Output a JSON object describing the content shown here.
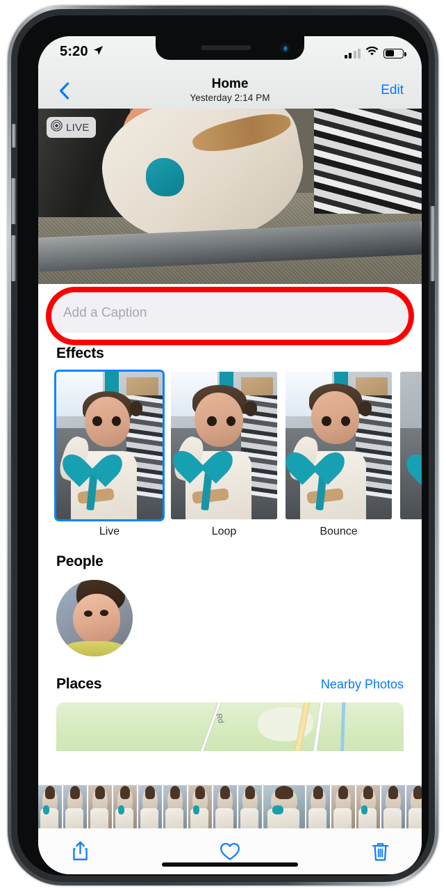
{
  "status_bar": {
    "time": "5:20",
    "location_icon": "location-arrow-icon",
    "signal_icon": "cellular-signal-icon",
    "signal_bars_filled": 2,
    "signal_bars_total": 4,
    "wifi_icon": "wifi-icon",
    "battery_icon": "battery-icon",
    "battery_percent": 45
  },
  "nav_bar": {
    "back_icon": "chevron-left-icon",
    "title": "Home",
    "subtitle": "Yesterday  2:14 PM",
    "edit_label": "Edit"
  },
  "photo": {
    "live_badge_label": "LIVE",
    "live_badge_icon": "live-photo-icon"
  },
  "caption": {
    "placeholder": "Add a Caption",
    "value": "",
    "annotation_color": "#ff0000"
  },
  "effects": {
    "title": "Effects",
    "items": [
      {
        "label": "Live",
        "selected": true
      },
      {
        "label": "Loop",
        "selected": false
      },
      {
        "label": "Bounce",
        "selected": false
      },
      {
        "label": "",
        "selected": false
      }
    ]
  },
  "people": {
    "title": "People",
    "faces": [
      {
        "name": "person-avatar"
      }
    ]
  },
  "places": {
    "title": "Places",
    "link_label": "Nearby Photos",
    "map_road_label": "Rd"
  },
  "filmstrip": {
    "thumbnail_count": 18
  },
  "toolbar": {
    "share_label": "Share",
    "share_icon": "share-icon",
    "favorite_label": "Favorite",
    "favorite_icon": "heart-icon",
    "delete_label": "Delete",
    "delete_icon": "trash-icon"
  },
  "theme": {
    "accent": "#007aff",
    "selection": "#0a84ff",
    "annotation": "#ff0000"
  }
}
